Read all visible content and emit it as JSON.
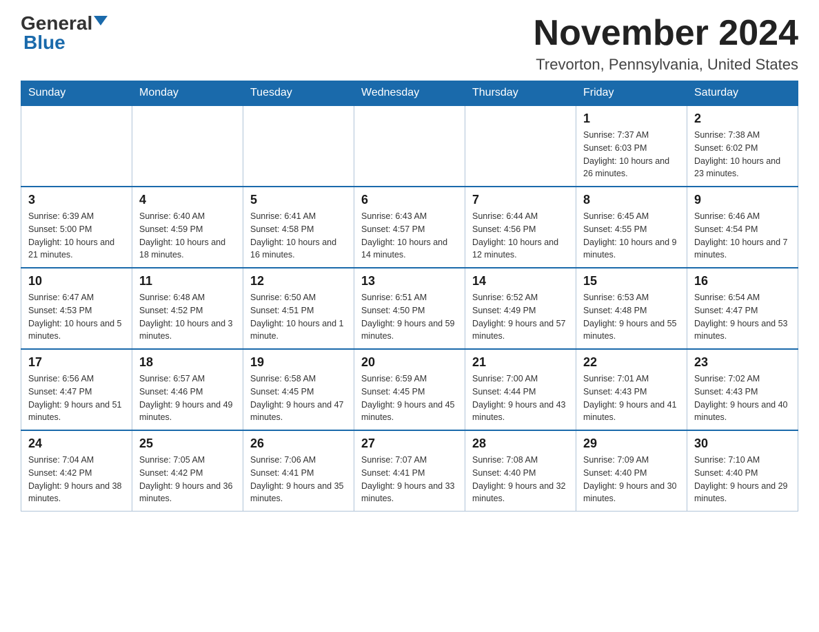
{
  "header": {
    "logo_general": "General",
    "logo_blue": "Blue",
    "month_title": "November 2024",
    "location": "Trevorton, Pennsylvania, United States"
  },
  "weekdays": [
    "Sunday",
    "Monday",
    "Tuesday",
    "Wednesday",
    "Thursday",
    "Friday",
    "Saturday"
  ],
  "weeks": [
    [
      {
        "day": "",
        "info": ""
      },
      {
        "day": "",
        "info": ""
      },
      {
        "day": "",
        "info": ""
      },
      {
        "day": "",
        "info": ""
      },
      {
        "day": "",
        "info": ""
      },
      {
        "day": "1",
        "info": "Sunrise: 7:37 AM\nSunset: 6:03 PM\nDaylight: 10 hours and 26 minutes."
      },
      {
        "day": "2",
        "info": "Sunrise: 7:38 AM\nSunset: 6:02 PM\nDaylight: 10 hours and 23 minutes."
      }
    ],
    [
      {
        "day": "3",
        "info": "Sunrise: 6:39 AM\nSunset: 5:00 PM\nDaylight: 10 hours and 21 minutes."
      },
      {
        "day": "4",
        "info": "Sunrise: 6:40 AM\nSunset: 4:59 PM\nDaylight: 10 hours and 18 minutes."
      },
      {
        "day": "5",
        "info": "Sunrise: 6:41 AM\nSunset: 4:58 PM\nDaylight: 10 hours and 16 minutes."
      },
      {
        "day": "6",
        "info": "Sunrise: 6:43 AM\nSunset: 4:57 PM\nDaylight: 10 hours and 14 minutes."
      },
      {
        "day": "7",
        "info": "Sunrise: 6:44 AM\nSunset: 4:56 PM\nDaylight: 10 hours and 12 minutes."
      },
      {
        "day": "8",
        "info": "Sunrise: 6:45 AM\nSunset: 4:55 PM\nDaylight: 10 hours and 9 minutes."
      },
      {
        "day": "9",
        "info": "Sunrise: 6:46 AM\nSunset: 4:54 PM\nDaylight: 10 hours and 7 minutes."
      }
    ],
    [
      {
        "day": "10",
        "info": "Sunrise: 6:47 AM\nSunset: 4:53 PM\nDaylight: 10 hours and 5 minutes."
      },
      {
        "day": "11",
        "info": "Sunrise: 6:48 AM\nSunset: 4:52 PM\nDaylight: 10 hours and 3 minutes."
      },
      {
        "day": "12",
        "info": "Sunrise: 6:50 AM\nSunset: 4:51 PM\nDaylight: 10 hours and 1 minute."
      },
      {
        "day": "13",
        "info": "Sunrise: 6:51 AM\nSunset: 4:50 PM\nDaylight: 9 hours and 59 minutes."
      },
      {
        "day": "14",
        "info": "Sunrise: 6:52 AM\nSunset: 4:49 PM\nDaylight: 9 hours and 57 minutes."
      },
      {
        "day": "15",
        "info": "Sunrise: 6:53 AM\nSunset: 4:48 PM\nDaylight: 9 hours and 55 minutes."
      },
      {
        "day": "16",
        "info": "Sunrise: 6:54 AM\nSunset: 4:47 PM\nDaylight: 9 hours and 53 minutes."
      }
    ],
    [
      {
        "day": "17",
        "info": "Sunrise: 6:56 AM\nSunset: 4:47 PM\nDaylight: 9 hours and 51 minutes."
      },
      {
        "day": "18",
        "info": "Sunrise: 6:57 AM\nSunset: 4:46 PM\nDaylight: 9 hours and 49 minutes."
      },
      {
        "day": "19",
        "info": "Sunrise: 6:58 AM\nSunset: 4:45 PM\nDaylight: 9 hours and 47 minutes."
      },
      {
        "day": "20",
        "info": "Sunrise: 6:59 AM\nSunset: 4:45 PM\nDaylight: 9 hours and 45 minutes."
      },
      {
        "day": "21",
        "info": "Sunrise: 7:00 AM\nSunset: 4:44 PM\nDaylight: 9 hours and 43 minutes."
      },
      {
        "day": "22",
        "info": "Sunrise: 7:01 AM\nSunset: 4:43 PM\nDaylight: 9 hours and 41 minutes."
      },
      {
        "day": "23",
        "info": "Sunrise: 7:02 AM\nSunset: 4:43 PM\nDaylight: 9 hours and 40 minutes."
      }
    ],
    [
      {
        "day": "24",
        "info": "Sunrise: 7:04 AM\nSunset: 4:42 PM\nDaylight: 9 hours and 38 minutes."
      },
      {
        "day": "25",
        "info": "Sunrise: 7:05 AM\nSunset: 4:42 PM\nDaylight: 9 hours and 36 minutes."
      },
      {
        "day": "26",
        "info": "Sunrise: 7:06 AM\nSunset: 4:41 PM\nDaylight: 9 hours and 35 minutes."
      },
      {
        "day": "27",
        "info": "Sunrise: 7:07 AM\nSunset: 4:41 PM\nDaylight: 9 hours and 33 minutes."
      },
      {
        "day": "28",
        "info": "Sunrise: 7:08 AM\nSunset: 4:40 PM\nDaylight: 9 hours and 32 minutes."
      },
      {
        "day": "29",
        "info": "Sunrise: 7:09 AM\nSunset: 4:40 PM\nDaylight: 9 hours and 30 minutes."
      },
      {
        "day": "30",
        "info": "Sunrise: 7:10 AM\nSunset: 4:40 PM\nDaylight: 9 hours and 29 minutes."
      }
    ]
  ]
}
